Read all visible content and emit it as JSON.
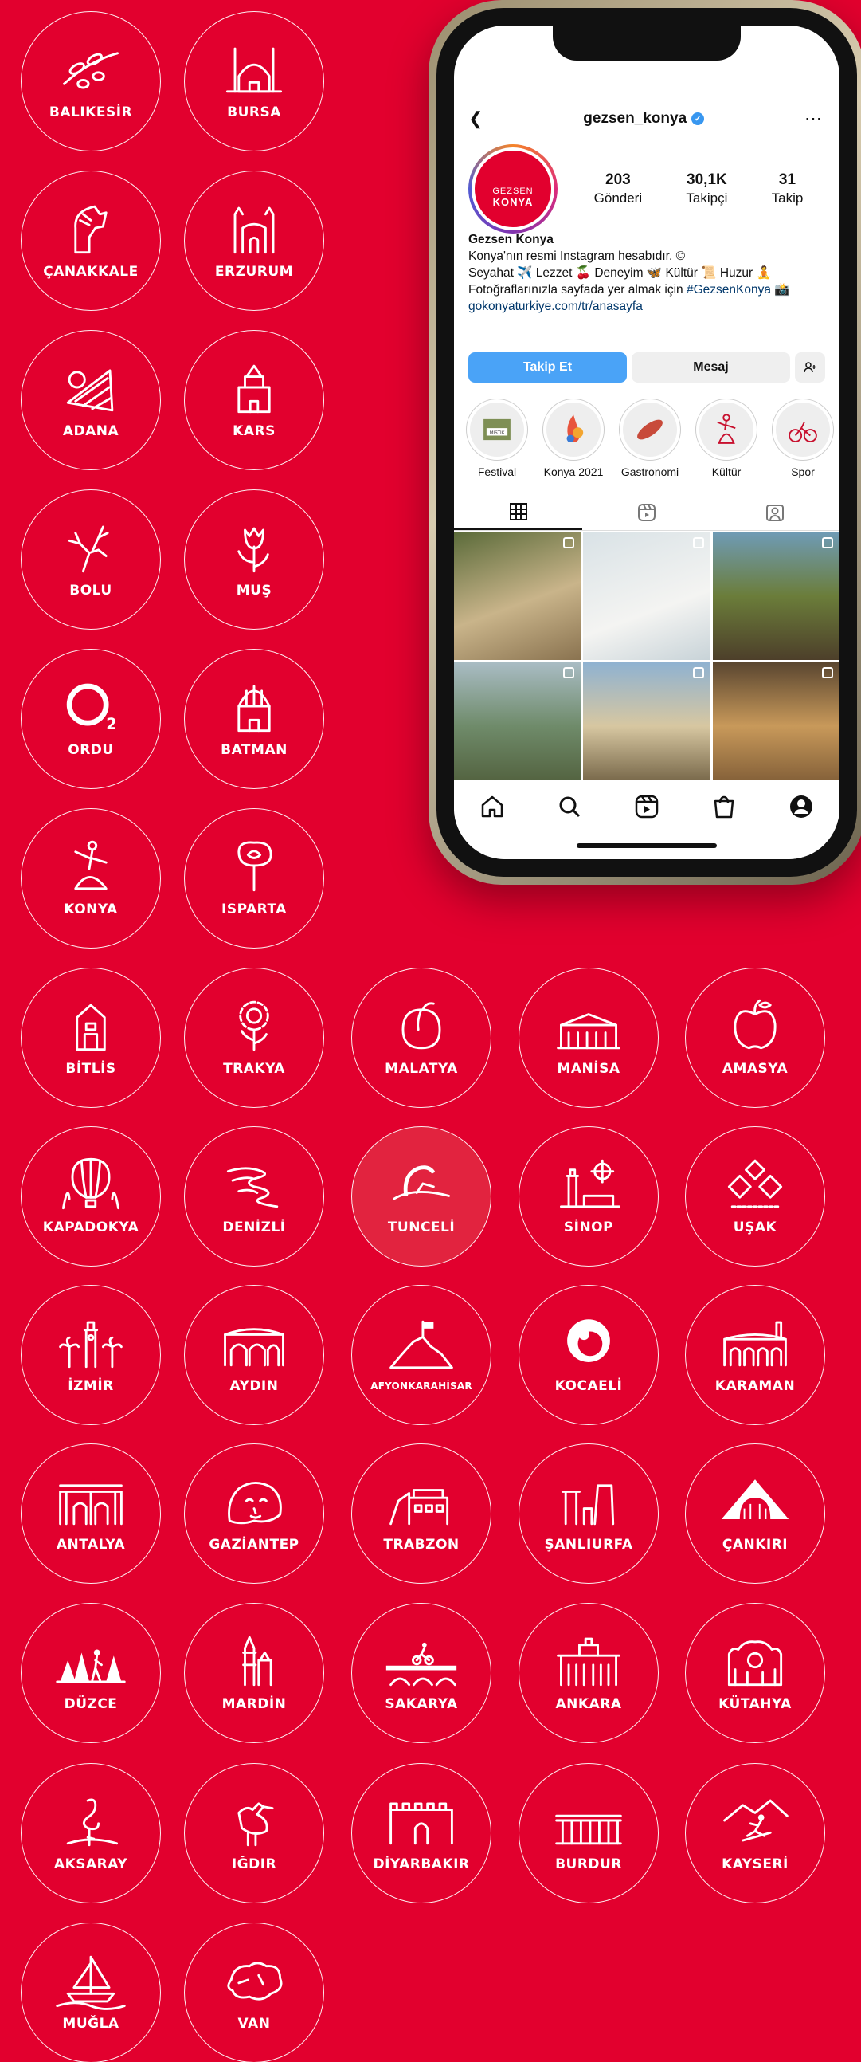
{
  "colors": {
    "background": "#E2002E",
    "follow_button": "#4aa3f7"
  },
  "provinces": [
    {
      "name": "BALIKESİR",
      "icon": "olive-branch-icon"
    },
    {
      "name": "BURSA",
      "icon": "mosque-icon"
    },
    {
      "name": "ÇANAKKALE",
      "icon": "trojan-horse-icon"
    },
    {
      "name": "ERZURUM",
      "icon": "twin-minaret-icon"
    },
    {
      "name": "ADANA",
      "icon": "citrus-slice-icon"
    },
    {
      "name": "KARS",
      "icon": "church-icon"
    },
    {
      "name": "BOLU",
      "icon": "deer-icon"
    },
    {
      "name": "MUŞ",
      "icon": "tulip-icon"
    },
    {
      "name": "ORDU",
      "icon": "o2-icon"
    },
    {
      "name": "BATMAN",
      "icon": "domed-building-icon"
    },
    {
      "name": "KONYA",
      "icon": "whirling-dervish-icon"
    },
    {
      "name": "ISPARTA",
      "icon": "rose-icon"
    },
    {
      "name": "BİTLİS",
      "icon": "tower-icon"
    },
    {
      "name": "TRAKYA",
      "icon": "sunflower-icon"
    },
    {
      "name": "MALATYA",
      "icon": "apricot-icon"
    },
    {
      "name": "MANİSA",
      "icon": "palace-icon"
    },
    {
      "name": "AMASYA",
      "icon": "apple-icon"
    },
    {
      "name": "KAPADOKYA",
      "icon": "hot-air-balloon-icon"
    },
    {
      "name": "DENİZLİ",
      "icon": "travertine-icon"
    },
    {
      "name": "TUNCELİ",
      "icon": "mountain-goat-icon"
    },
    {
      "name": "SİNOP",
      "icon": "lighthouse-compass-icon"
    },
    {
      "name": "UŞAK",
      "icon": "carpet-ornament-icon"
    },
    {
      "name": "İZMİR",
      "icon": "clock-tower-palm-icon"
    },
    {
      "name": "AYDIN",
      "icon": "ancient-arches-icon"
    },
    {
      "name": "AFYONKARAHİSAR",
      "icon": "castle-hill-flag-icon"
    },
    {
      "name": "KOCAELİ",
      "icon": "kocaeli-logo-icon"
    },
    {
      "name": "KARAMAN",
      "icon": "arcade-building-icon"
    },
    {
      "name": "ANTALYA",
      "icon": "hadrian-gate-icon"
    },
    {
      "name": "GAZİANTEP",
      "icon": "gypsy-girl-mosaic-icon"
    },
    {
      "name": "TRABZON",
      "icon": "monastery-cliff-icon"
    },
    {
      "name": "ŞANLIURFA",
      "icon": "gobeklitepe-pillars-icon"
    },
    {
      "name": "ÇANKIRI",
      "icon": "salt-mountain-icon"
    },
    {
      "name": "DÜZCE",
      "icon": "forest-hiker-icon"
    },
    {
      "name": "MARDİN",
      "icon": "minaret-icon"
    },
    {
      "name": "SAKARYA",
      "icon": "bridge-cyclist-icon"
    },
    {
      "name": "ANKARA",
      "icon": "parliament-icon"
    },
    {
      "name": "KÜTAHYA",
      "icon": "ornate-facade-icon"
    },
    {
      "name": "AKSARAY",
      "icon": "flamingo-icon"
    },
    {
      "name": "IĞDIR",
      "icon": "stork-icon"
    },
    {
      "name": "DİYARBAKIR",
      "icon": "city-walls-icon"
    },
    {
      "name": "BURDUR",
      "icon": "colonnade-icon"
    },
    {
      "name": "KAYSERİ",
      "icon": "skier-mountain-icon"
    },
    {
      "name": "MUĞLA",
      "icon": "sailboat-icon"
    },
    {
      "name": "VAN",
      "icon": "lake-map-icon"
    }
  ],
  "instagram": {
    "username": "gezsen_konya",
    "avatar_line1": "GEZSEN",
    "avatar_line2": "KONYA",
    "stats": [
      {
        "num": "203",
        "label": "Gönderi"
      },
      {
        "num": "30,1K",
        "label": "Takipçi"
      },
      {
        "num": "31",
        "label": "Takip"
      }
    ],
    "bio_name": "Gezsen Konya",
    "bio_line1": "Konya'nın resmi Instagram hesabıdır. ©",
    "bio_line2": "Seyahat ✈️ Lezzet 🍒 Deneyim 🦋 Kültür 📜 Huzur 🧘",
    "bio_line3_prefix": "Fotoğraflarınızla sayfada yer almak için ",
    "bio_hashtag": "#GezsenKonya",
    "bio_line3_suffix": " 📸",
    "bio_link": "gokonyaturkiye.com/tr/anasayfa",
    "follow_label": "Takip Et",
    "message_label": "Mesaj",
    "highlights": [
      "Festival",
      "Konya 2021",
      "Gastronomi",
      "Kültür",
      "Spor"
    ],
    "highlight_icons": [
      "festival-poster-icon",
      "konya-2021-logo-icon",
      "gastronomy-icon",
      "dervish-icon",
      "cycling-icon"
    ]
  }
}
